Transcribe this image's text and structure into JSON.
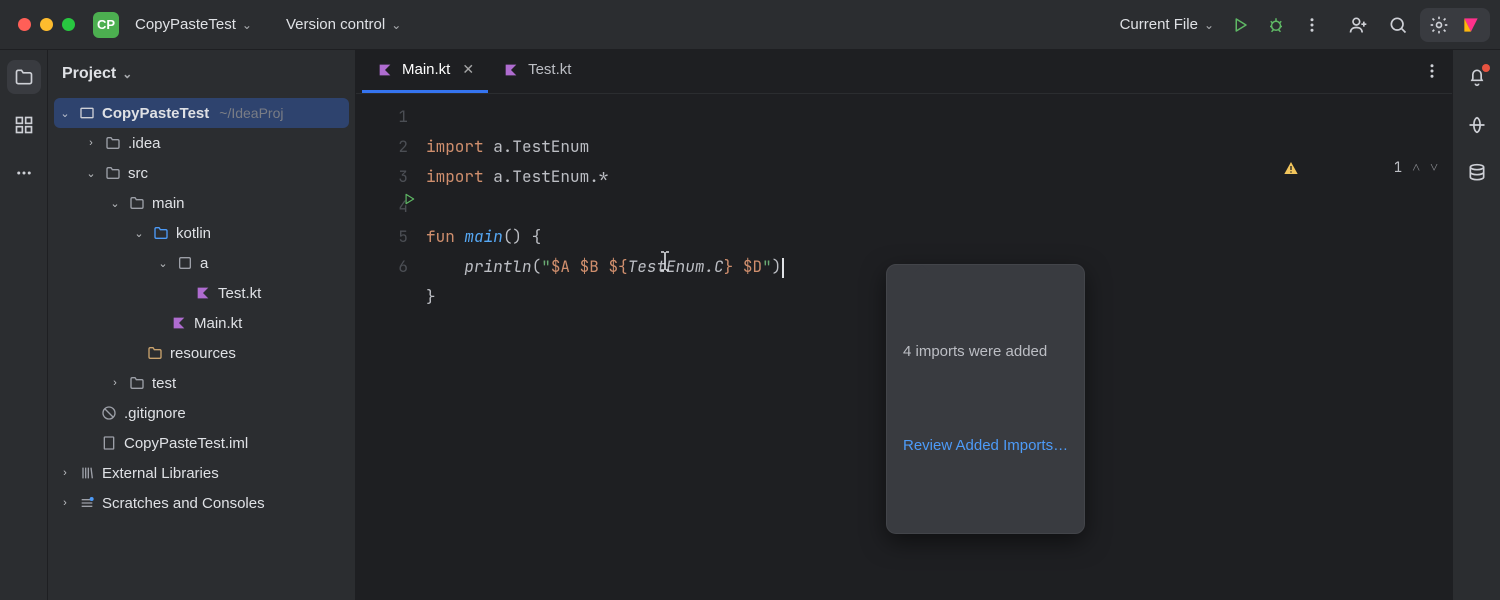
{
  "titlebar": {
    "project_badge": "CP",
    "project_name": "CopyPasteTest",
    "vcs_label": "Version control",
    "run_config": "Current File"
  },
  "project_panel": {
    "title": "Project"
  },
  "tree": {
    "root": "CopyPasteTest",
    "root_path": "~/IdeaProj",
    "idea": ".idea",
    "src": "src",
    "main": "main",
    "kotlin": "kotlin",
    "pkg_a": "a",
    "test_kt": "Test.kt",
    "main_kt": "Main.kt",
    "resources": "resources",
    "test": "test",
    "gitignore": ".gitignore",
    "iml": "CopyPasteTest.iml",
    "ext_lib": "External Libraries",
    "scratches": "Scratches and Consoles"
  },
  "tabs": {
    "main": "Main.kt",
    "test": "Test.kt"
  },
  "code": {
    "l1a": "import",
    "l1b": " a.TestEnum",
    "l2a": "import",
    "l2b": " a.TestEnum.*",
    "l4a": "fun ",
    "l4b": "main",
    "l4c": "() {",
    "l5a": "    ",
    "l5b": "println",
    "l5c": "(",
    "l5d": "\"",
    "l5e": "$A",
    "l5f": " ",
    "l5g": "$B",
    "l5h": " ",
    "l5i": "${",
    "l5j": "TestEnum.C",
    "l5k": "}",
    "l5l": " ",
    "l5m": "$D",
    "l5n": "\"",
    "l5o": ")",
    "l6": "}"
  },
  "gutter": {
    "n1": "1",
    "n2": "2",
    "n3": "3",
    "n4": "4",
    "n5": "5",
    "n6": "6"
  },
  "inspections": {
    "warn_count": "1"
  },
  "popup": {
    "msg": "4 imports were added",
    "link": "Review Added Imports…"
  }
}
